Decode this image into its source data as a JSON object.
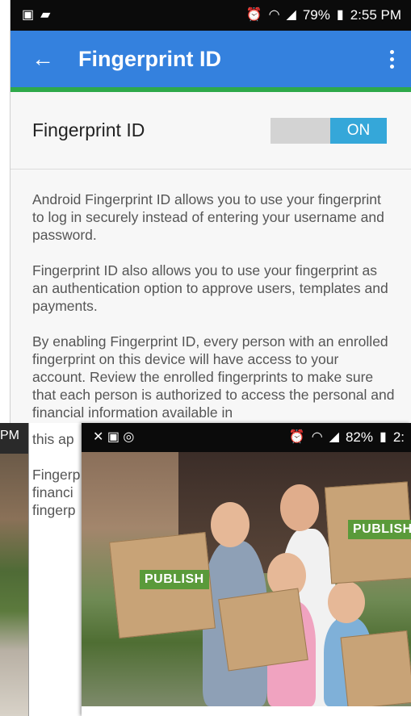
{
  "main": {
    "statusbar": {
      "left_icons": [
        "image-icon",
        "chat-icon"
      ],
      "alarm_glyph": "⏰",
      "wifi_glyph": "◠",
      "signal_glyph": "◢",
      "battery": "79%",
      "battery_glyph": "▮",
      "time": "2:55 PM"
    },
    "appbar": {
      "back_glyph": "←",
      "title": "Fingerprint ID"
    },
    "setting": {
      "label": "Fingerprint ID",
      "toggle_state": "ON"
    },
    "paragraphs": [
      "Android Fingerprint ID allows you to use your fingerprint to log in securely instead of entering your username and password.",
      "Fingerprint ID also allows you to use your fingerprint as an authentication option to approve users, templates and payments.",
      "By enabling Fingerprint ID, every person with an enrolled fingerprint on this device will have access to your account. Review the enrolled fingerprints to make sure that each person is authorized to access the personal and financial information available in"
    ]
  },
  "left": {
    "time_fragment": "PM"
  },
  "mid": {
    "lines": [
      "this ap",
      "Fingerp",
      "financi",
      "fingerp"
    ]
  },
  "front": {
    "statusbar": {
      "left_icons": [
        "missed-call-icon",
        "image-icon",
        "sync-icon"
      ],
      "left_glyphs": "✕ ▣ ◎",
      "alarm_glyph": "⏰",
      "wifi_glyph": "◠",
      "signal_glyph": "◢",
      "battery": "82%",
      "battery_glyph": "▮",
      "time": "2:"
    },
    "publish_left": "PUBLISH",
    "publish_right": "PUBLISH"
  },
  "colors": {
    "appbar": "#3481de",
    "appbar_underline": "#2ea94a",
    "toggle_on": "#35a7d9",
    "publish_label": "#5a9a3a"
  }
}
